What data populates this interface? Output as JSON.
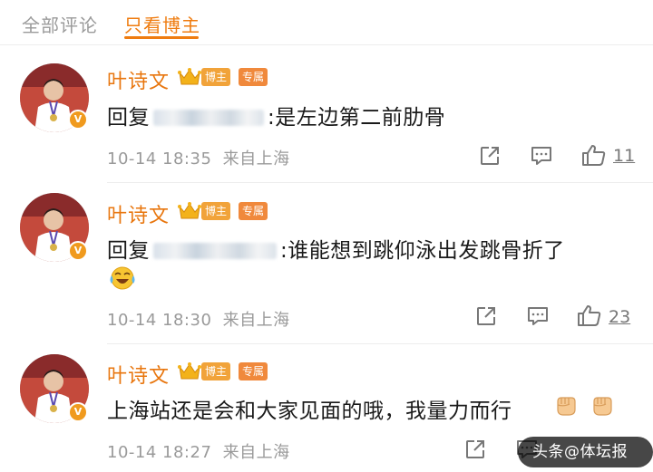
{
  "tabs": {
    "all": "全部评论",
    "blogger_only": "只看博主"
  },
  "badges": {
    "blogger": "博主",
    "column": "专属"
  },
  "comments": [
    {
      "username": "叶诗文",
      "reply_prefix": "回复",
      "text": ":是左边第二前肋骨",
      "timestamp": "10-14 18:35",
      "location": "来自上海",
      "likes": "11"
    },
    {
      "username": "叶诗文",
      "reply_prefix": "回复",
      "text": ":谁能想到跳仰泳出发跳骨折了",
      "timestamp": "10-14 18:30",
      "location": "来自上海",
      "likes": "23"
    },
    {
      "username": "叶诗文",
      "reply_prefix": "",
      "text": "上海站还是会和大家见面的哦，我量力而行",
      "timestamp": "10-14 18:27",
      "location": "来自上海",
      "likes": ""
    }
  ],
  "icons": {
    "share": "share-icon",
    "comment": "comment-icon",
    "like": "thumbs-up-icon",
    "verified": "verified-v-icon",
    "crown": "crown-icon"
  },
  "colors": {
    "accent": "#ef7c10",
    "username": "#e8760e",
    "meta": "#9a9a9a"
  },
  "watermark": "头条@体坛报"
}
